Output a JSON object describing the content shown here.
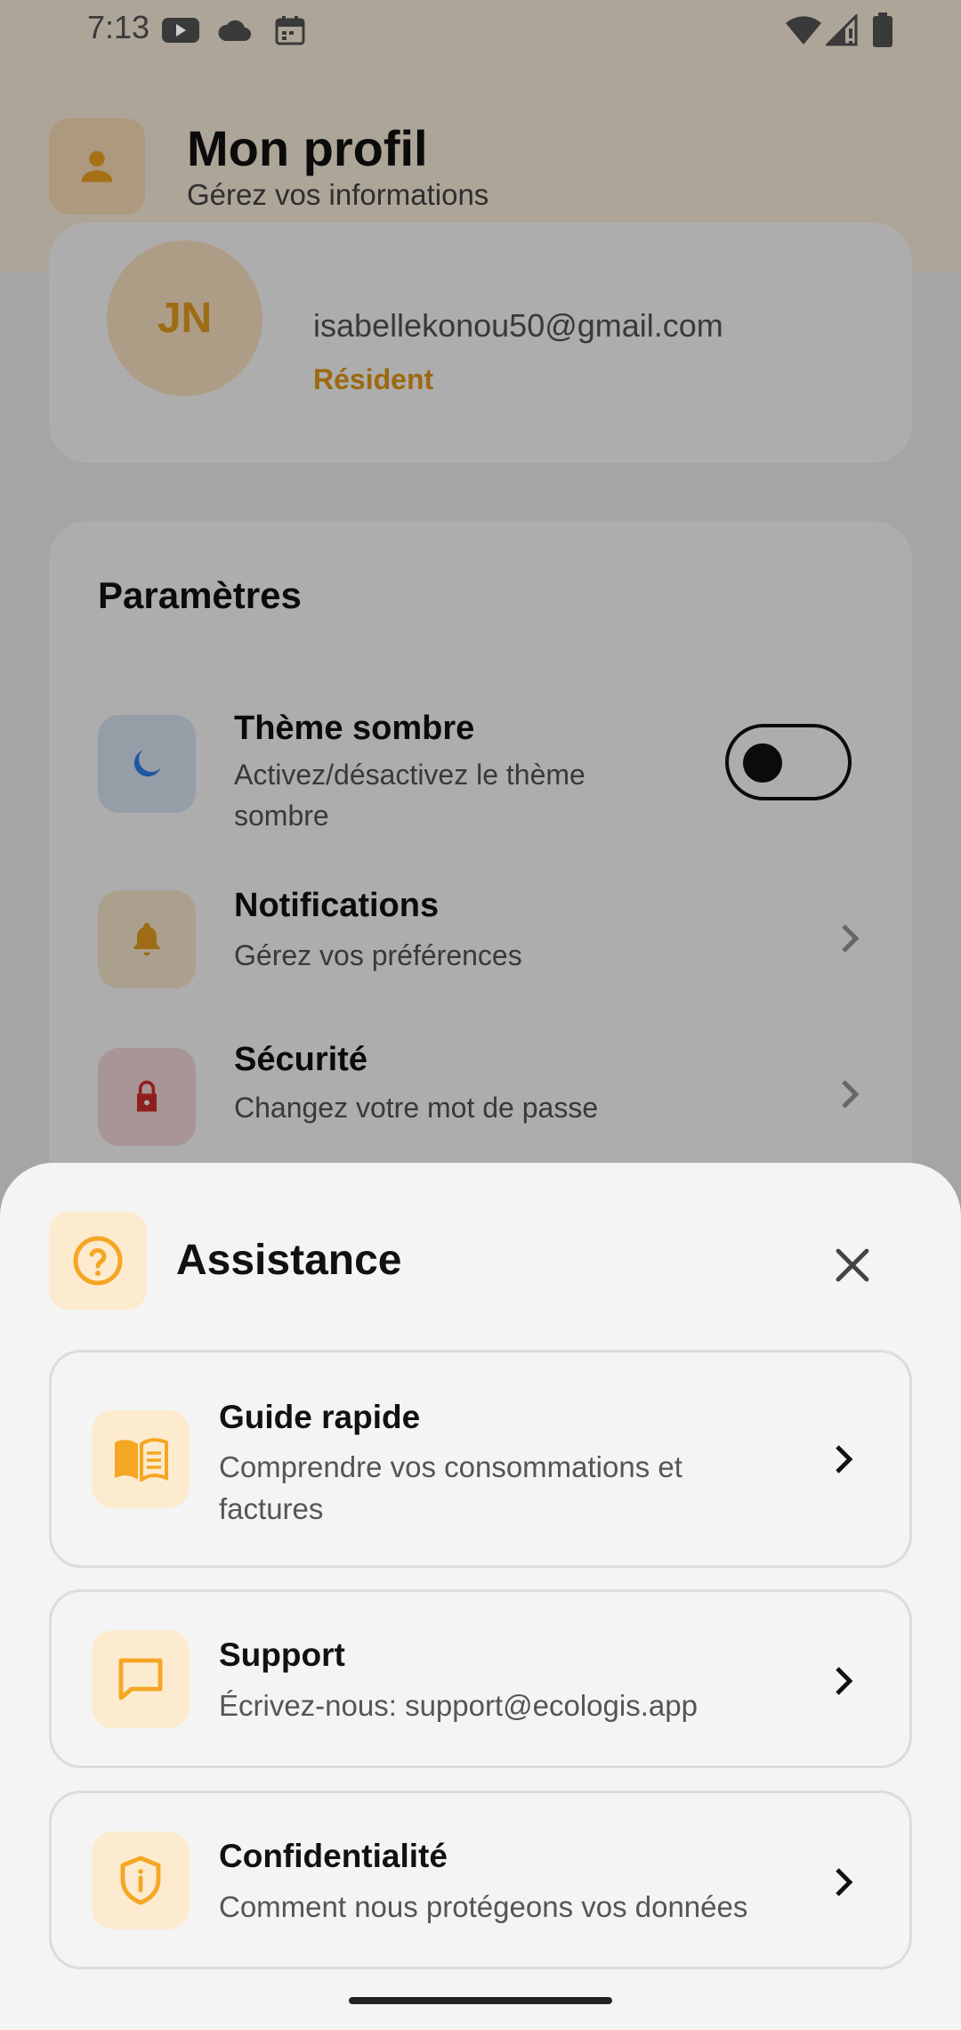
{
  "status_bar": {
    "time": "7:13"
  },
  "header": {
    "title": "Mon profil",
    "subtitle": "Gérez vos informations"
  },
  "profile": {
    "initials": "JN",
    "email": "isabellekonou50@gmail.com",
    "role": "Résident"
  },
  "settings": {
    "title": "Paramètres",
    "items": [
      {
        "title": "Thème sombre",
        "subtitle_line1": "Activez/désactivez le thème",
        "subtitle_line2": "sombre",
        "toggle_on": false
      },
      {
        "title": "Notifications",
        "subtitle": "Gérez vos préférences"
      },
      {
        "title": "Sécurité",
        "subtitle": "Changez votre mot de passe"
      }
    ]
  },
  "sheet": {
    "title": "Assistance",
    "options": [
      {
        "title": "Guide rapide",
        "subtitle_line1": "Comprendre vos consommations et",
        "subtitle_line2": "factures"
      },
      {
        "title": "Support",
        "subtitle": "Écrivez-nous: support@ecologis.app"
      },
      {
        "title": "Confidentialité",
        "subtitle": "Comment nous protégeons vos données"
      }
    ]
  },
  "colors": {
    "accent": "#F5A623",
    "accent_light": "#FDEBD0",
    "moon": "#2F80ED",
    "lock": "#D32F2F",
    "bell": "#E8A020"
  }
}
